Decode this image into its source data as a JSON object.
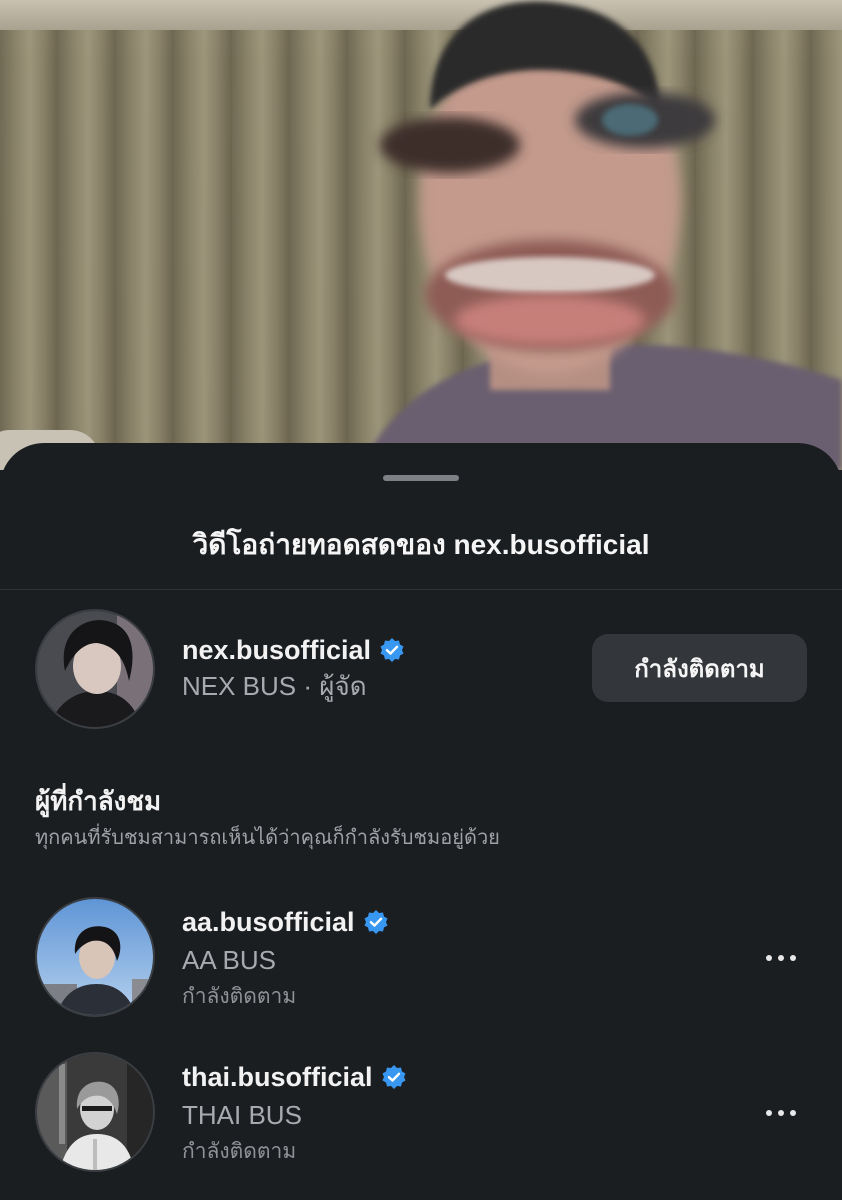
{
  "sheet": {
    "title": "วิดีโอถ่ายทอดสดของ nex.busofficial"
  },
  "host": {
    "username": "nex.busofficial",
    "display_name": "NEX BUS",
    "separator": " · ",
    "role": "ผู้จัด",
    "verified": true,
    "follow_button": "กำลังติดตาม"
  },
  "viewers_section": {
    "title": "ผู้ที่กำลังชม",
    "description": "ทุกคนที่รับชมสามารถเห็นได้ว่าคุณก็กำลังรับชมอยู่ด้วย"
  },
  "viewers": [
    {
      "username": "aa.busofficial",
      "display_name": "AA BUS",
      "status": "กำลังติดตาม",
      "verified": true
    },
    {
      "username": "thai.busofficial",
      "display_name": "THAI BUS",
      "status": "กำลังติดตาม",
      "verified": true
    }
  ],
  "colors": {
    "sheet_bg": "#1b1e21",
    "verified_badge": "#3897f0",
    "button_bg": "#33373b"
  },
  "icons": {
    "verified": "verified-badge-icon",
    "more": "more-horizontal-icon"
  }
}
